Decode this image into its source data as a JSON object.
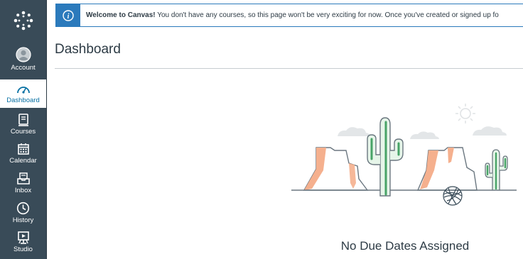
{
  "nav": {
    "items": [
      {
        "label": "Account",
        "icon": "account-icon"
      },
      {
        "label": "Dashboard",
        "icon": "dashboard-icon"
      },
      {
        "label": "Courses",
        "icon": "courses-icon"
      },
      {
        "label": "Calendar",
        "icon": "calendar-icon"
      },
      {
        "label": "Inbox",
        "icon": "inbox-icon"
      },
      {
        "label": "History",
        "icon": "history-icon"
      },
      {
        "label": "Studio",
        "icon": "studio-icon"
      }
    ],
    "active": "Dashboard",
    "colors": {
      "nav_bg": "#394b58",
      "active_text": "#0770a3"
    }
  },
  "banner": {
    "bold": "Welcome to Canvas!",
    "text": " You don't have any courses, so this page won't be very exciting for now. Once you've created or signed up fo",
    "icon": "info-icon",
    "accent": "#2b7abc"
  },
  "page": {
    "title": "Dashboard",
    "empty_message": "No Due Dates Assigned",
    "illustration": "desert-cactus-illustration"
  }
}
